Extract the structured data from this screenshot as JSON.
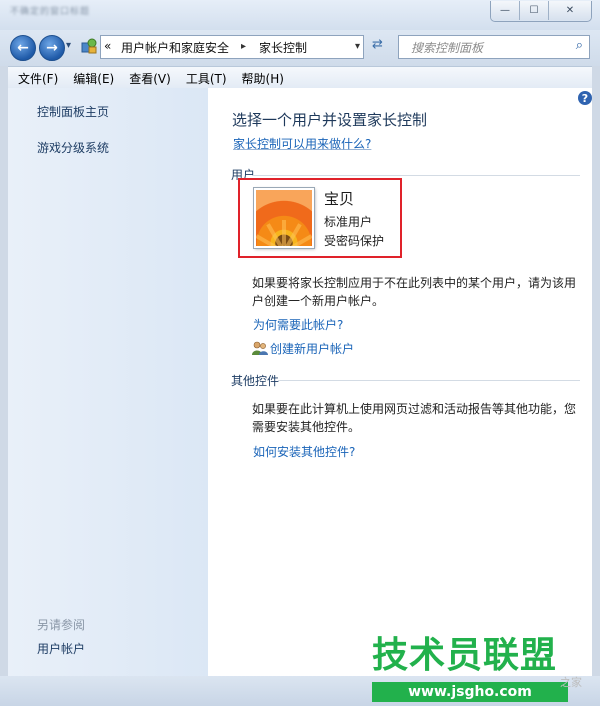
{
  "window": {
    "blurred_title": "不确定的窗口标题",
    "buttons": {
      "minimize": "—",
      "maximize": "☐",
      "close": "✕"
    }
  },
  "address": {
    "chevrons": "«",
    "crumb1": "用户帐户和家庭安全",
    "separator": "▸",
    "crumb2": "家长控制",
    "dropdown": "▾",
    "search_placeholder": "搜索控制面板"
  },
  "menu": [
    {
      "label": "文件(F)"
    },
    {
      "label": "编辑(E)"
    },
    {
      "label": "查看(V)"
    },
    {
      "label": "工具(T)"
    },
    {
      "label": "帮助(H)"
    }
  ],
  "sidebar": {
    "items": [
      {
        "label": "控制面板主页"
      },
      {
        "label": "游戏分级系统"
      }
    ],
    "see_also_title": "另请参阅",
    "see_also_items": [
      {
        "label": "用户帐户"
      }
    ]
  },
  "main": {
    "heading": "选择一个用户并设置家长控制",
    "what_link": "家长控制可以用来做什么?",
    "users_section": "用户",
    "user": {
      "name": "宝贝",
      "type": "标准用户",
      "status": "受密码保护"
    },
    "create_para": "如果要将家长控制应用于不在此列表中的某个用户，请为该用户创建一个新用户帐户。",
    "why_link": "为何需要此帐户?",
    "create_link": "创建新用户帐户",
    "other_section": "其他控件",
    "other_para": "如果要在此计算机上使用网页过滤和活动报告等其他功能，您需要安装其他控件。",
    "install_link": "如何安装其他控件?",
    "help_glyph": "?"
  },
  "watermark": {
    "big": "技术员联盟",
    "url": "www.jsgho.com",
    "ghost": "之家"
  },
  "colors": {
    "highlight_border": "#e0222a",
    "link": "#1a64b8",
    "watermark_green": "#22b14c"
  }
}
